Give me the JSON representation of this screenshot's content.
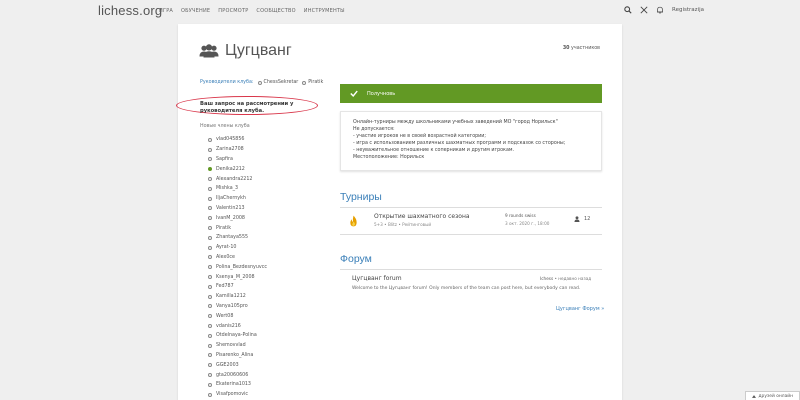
{
  "header": {
    "logo": "lichess.org",
    "nav": [
      "ИГРА",
      "ОБУЧЕНИЕ",
      "ПРОСМОТР",
      "СООБЩЕСТВО",
      "ИНСТРУМЕНТЫ"
    ],
    "signin": "Registrazija"
  },
  "club": {
    "title": "Цугцванг",
    "members_count": "30",
    "members_suffix": "участников",
    "leaders_label": "Руководители клуба:",
    "leaders": [
      "ChessSekretar",
      "Piratik"
    ],
    "pending_text": "Ваш запрос на рассмотрении у руководителя клуба.",
    "new_members_label": "Новые члены клуба",
    "members": [
      {
        "name": "vlad045856",
        "online": false
      },
      {
        "name": "Zarina2708",
        "online": false
      },
      {
        "name": "Sapfira",
        "online": false
      },
      {
        "name": "Denika2212",
        "online": true
      },
      {
        "name": "Alexandra2212",
        "online": false
      },
      {
        "name": "Mishka_3",
        "online": false
      },
      {
        "name": "IljaChernykh",
        "online": false
      },
      {
        "name": "Valentin213",
        "online": false
      },
      {
        "name": "IvanM_2008",
        "online": false
      },
      {
        "name": "Piratik",
        "online": false
      },
      {
        "name": "Zhantaya555",
        "online": false
      },
      {
        "name": "Ayrat-10",
        "online": false
      },
      {
        "name": "Alex0ce",
        "online": false
      },
      {
        "name": "Polina_Bezdesnyuvcc",
        "online": false
      },
      {
        "name": "Ksenya_M_2008",
        "online": false
      },
      {
        "name": "Fed787",
        "online": false
      },
      {
        "name": "Kamilla1212",
        "online": false
      },
      {
        "name": "Vanya105pro",
        "online": false
      },
      {
        "name": "Wert08",
        "online": false
      },
      {
        "name": "vdanis216",
        "online": false
      },
      {
        "name": "Otdelnaya-Polina",
        "online": false
      },
      {
        "name": "Shemovvlad",
        "online": false
      },
      {
        "name": "Pisarenko_Alina",
        "online": false
      },
      {
        "name": "GGE2003",
        "online": false
      },
      {
        "name": "gta20060606",
        "online": false
      },
      {
        "name": "Ekaterina1013",
        "online": false
      },
      {
        "name": "Visafpomovic",
        "online": false
      }
    ]
  },
  "banner": {
    "label": "Получновь",
    "color": "#629924"
  },
  "description": [
    "Онлайн-турниры между школьниками учебных заведений МО \"город Норильск\"",
    "Не допускается:",
    "- участие игроков не в своей возрастной категории;",
    "- игра с использованием различных шахматных программ и подсказок со стороны;",
    "- неуважительное отношение к соперникам и другим игрокам.",
    "Местоположение: Норильск"
  ],
  "tournaments": {
    "section_title": "Турниры",
    "items": [
      {
        "name": "Открытие шахматного сезона",
        "meta": "5+3 • Blitz • Рейтинговый",
        "rounds": "9 rounds swiss",
        "date": "3 окт. 2020 г., 18:00",
        "players": "12"
      }
    ]
  },
  "forum": {
    "section_title": "Форум",
    "name": "Цугцванг forum",
    "author": "Ichess",
    "time": "• недавно назад",
    "description": "Welcome to the Цугцванг forum! Only members of the team can post here, but everybody can read.",
    "link": "Цугцванг Форум »"
  },
  "friends": {
    "label": "друзей онлайн"
  },
  "colors": {
    "accent_link": "#3a7fb8",
    "success": "#629924",
    "highlight_ring": "#d9374b"
  }
}
